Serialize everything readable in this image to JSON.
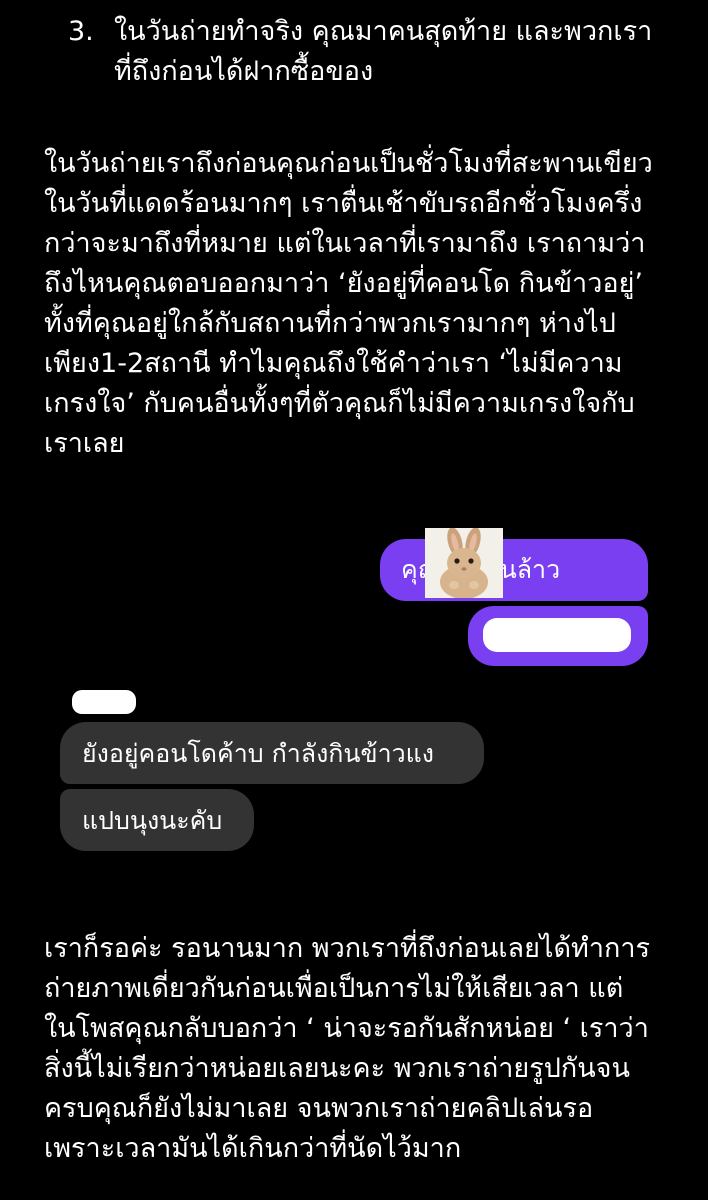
{
  "numbered_item": {
    "number": "3.",
    "lines": [
      "ในวันถ่ายทำจริง คุณมาคนสุดท้าย และพวกเรา",
      "ที่ถึงก่อนได้ฝากซื้อของ"
    ]
  },
  "paragraph_1": {
    "lines": [
      "ในวันถ่ายเราถึงก่อนคุณก่อนเป็นชั่วโมงที่สะพานเขียว",
      "ในวันที่แดดร้อนมากๆ เราตื่นเช้าขับรถอีกชั่วโมงครึ่ง",
      "กว่าจะมาถึงที่หมาย แต่ในเวลาที่เรามาถึง เราถามว่า",
      "ถึงไหนคุณตอบออกมาว่า ‘ยังอยู่ที่คอนโด กินข้าวอยู่’",
      "ทั้งที่คุณอยู่ใกล้กับสถานที่กว่าพวกเรามากๆ ห่างไป",
      "เพียง1-2สถานี ทำไมคุณถึงใช้คำว่าเรา ‘ไม่มีความ",
      "เกรงใจ’ กับคนอื่นทั้งๆที่ตัวคุณก็ไม่มีความเกรงใจกับ",
      "เราเลย"
    ]
  },
  "chat": {
    "sent_message_1": "คุณอยู่ไหนล้าว",
    "received_message_1": "ยังอยู่คอนโดค้าบ กำลังกินข้าวแง",
    "received_message_2": "แปบนุงนะคับ",
    "sticker": "rabbit-sticker",
    "colors": {
      "sent_bubble": "#7a3ff0",
      "received_bubble": "#333333",
      "redaction": "#ffffff"
    }
  },
  "paragraph_2": {
    "lines": [
      "เราก็รอค่ะ รอนานมาก พวกเราที่ถึงก่อนเลยได้ทำการ",
      "ถ่ายภาพเดี่ยวกันก่อนเพื่อเป็นการไม่ให้เสียเวลา แต่",
      "ในโพสคุณกลับบอกว่า ‘ น่าจะรอกันสักหน่อย ‘ เราว่า",
      "สิ่งนี้ไม่เรียกว่าหน่อยเลยนะคะ พวกเราถ่ายรูปกันจน",
      "ครบคุณก็ยังไม่มาเลย จนพวกเราถ่ายคลิปเล่นรอ",
      "เพราะเวลามันได้เกินกว่าที่นัดไว้มาก"
    ]
  },
  "theme": {
    "background": "#000000",
    "text": "#ffffff"
  }
}
